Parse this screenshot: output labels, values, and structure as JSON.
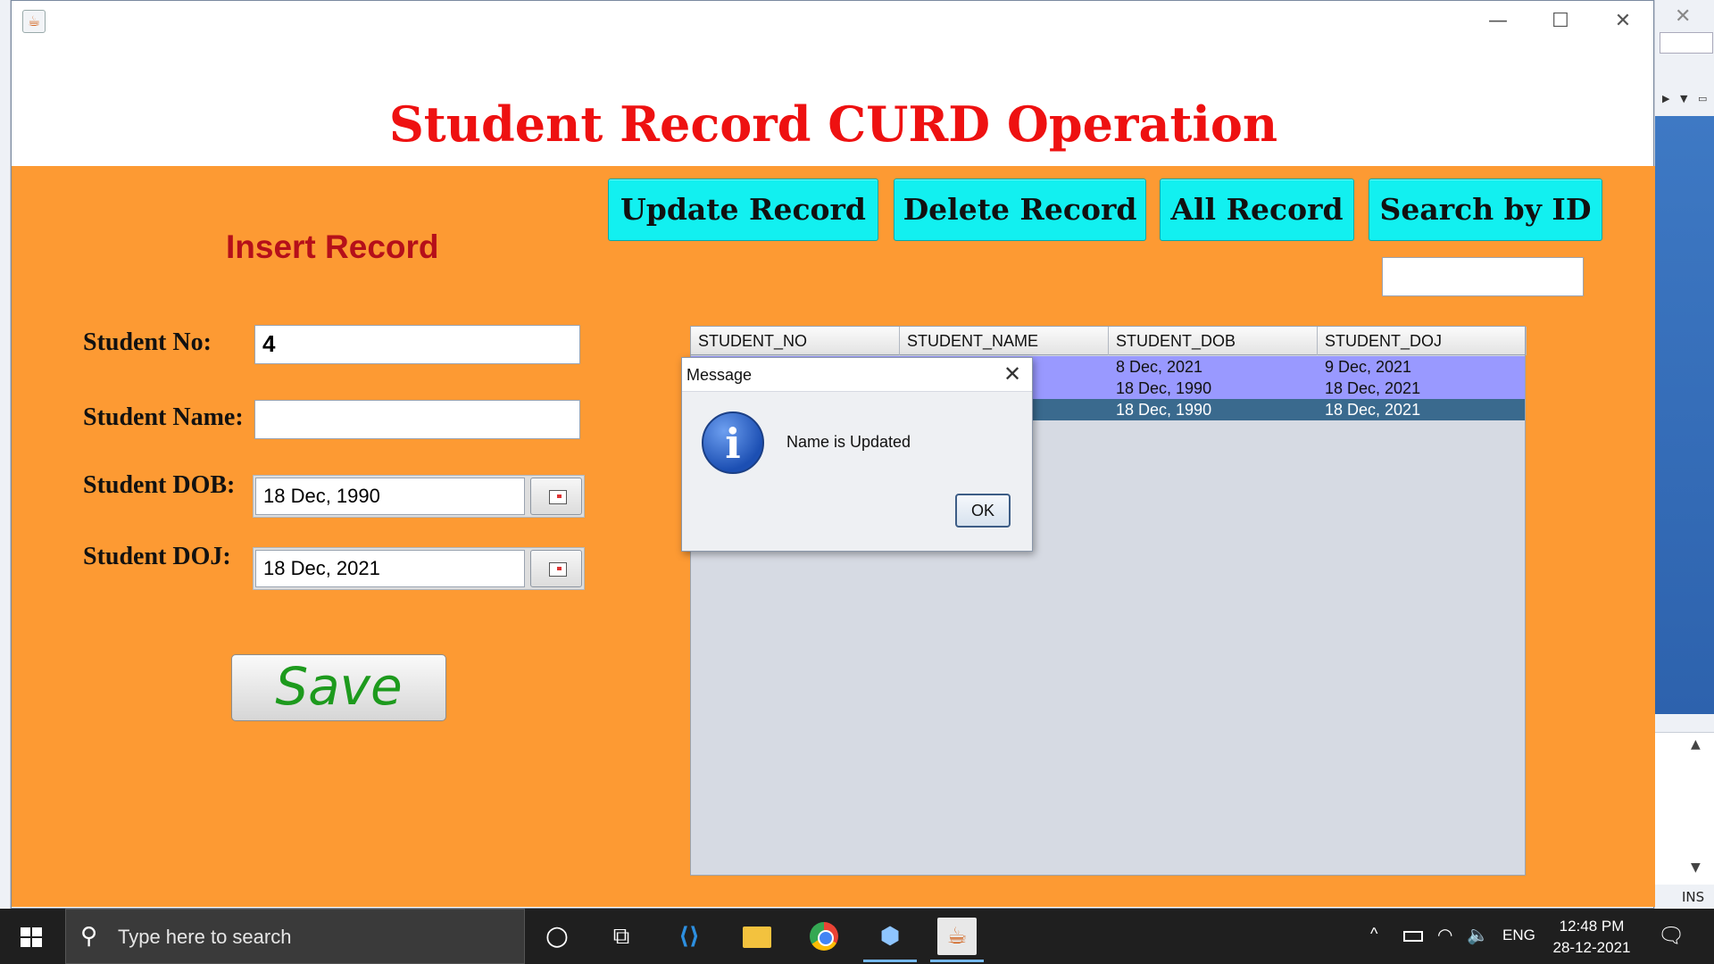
{
  "window": {
    "title": "Student Record CURD Operation",
    "minimize": "—",
    "maximize": "☐",
    "close": "✕"
  },
  "insert_section": {
    "title": "Insert Record",
    "fields": [
      {
        "label": "Student No:",
        "value": "4"
      },
      {
        "label": "Student Name:",
        "value": ""
      },
      {
        "label": "Student DOB:",
        "value": "18 Dec, 1990"
      },
      {
        "label": "Student DOJ:",
        "value": "18 Dec, 2021"
      }
    ],
    "save_label": "Save"
  },
  "toolbar": {
    "update_label": "Update Record",
    "delete_label": "Delete Record",
    "all_label": "All Record",
    "search_label": "Search by ID",
    "search_value": ""
  },
  "table": {
    "columns": [
      "STUDENT_NO",
      "STUDENT_NAME",
      "STUDENT_DOB",
      "STUDENT_DOJ"
    ],
    "rows": [
      {
        "no": "",
        "name": "",
        "dob": "8 Dec, 2021",
        "doj": "9 Dec, 2021"
      },
      {
        "no": "",
        "name": "",
        "dob": "18 Dec, 1990",
        "doj": "18 Dec, 2021"
      },
      {
        "no": "",
        "name": "",
        "dob": "18 Dec, 1990",
        "doj": "18 Dec, 2021"
      }
    ],
    "selected_row": 2,
    "colors": {
      "row_normal": "#9999ff",
      "row_selected": "#3a6a8e"
    }
  },
  "dialog": {
    "title": "Message",
    "message": "Name is Updated",
    "ok_label": "OK",
    "icon": "info-icon"
  },
  "taskbar": {
    "search_placeholder": "Type here to search",
    "language": "ENG",
    "time": "12:48 PM",
    "date": "28-12-2021",
    "apps": [
      "cortana-icon",
      "task-view-icon",
      "vscode-icon",
      "file-explorer-icon",
      "chrome-icon",
      "virtualbox-icon",
      "java-icon"
    ]
  },
  "ide": {
    "status": "INS"
  },
  "colors": {
    "background": "#fd9a33",
    "title_red": "#ee1111",
    "insert_red": "#b5101a",
    "button_cyan": "#12f0f0",
    "save_green": "#1d9a1d"
  }
}
